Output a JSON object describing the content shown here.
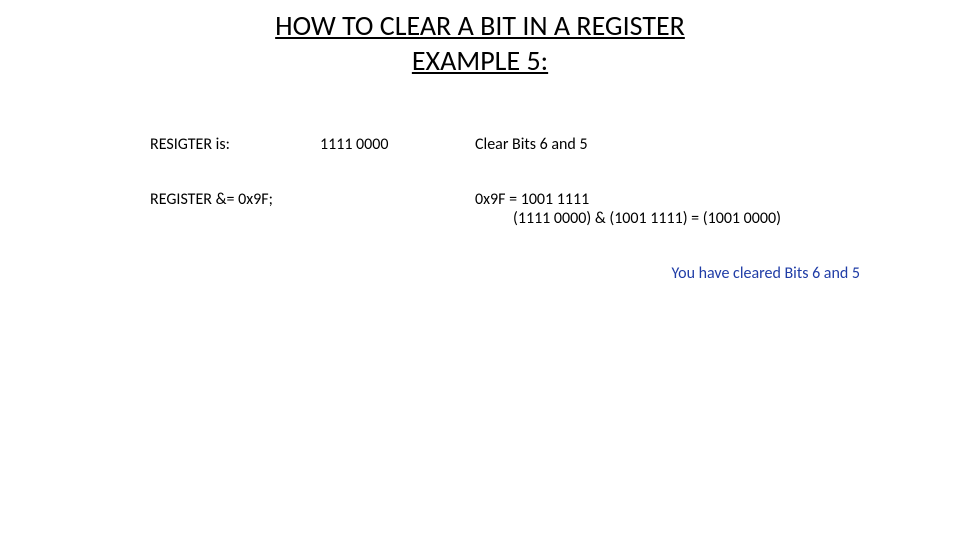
{
  "title_line1": "HOW TO CLEAR A BIT IN A REGISTER",
  "title_line2": "EXAMPLE 5:",
  "row1": {
    "label": "RESIGTER is:",
    "value": "1111 0000",
    "instruction": "Clear Bits 6 and 5"
  },
  "row2": {
    "code": "REGISTER &= 0x9F;",
    "expansion": "0x9F =  1001 1111",
    "calc": "(1111 0000)   & (1001 1111) = (1001 0000)"
  },
  "result": "You have cleared Bits 6 and 5"
}
